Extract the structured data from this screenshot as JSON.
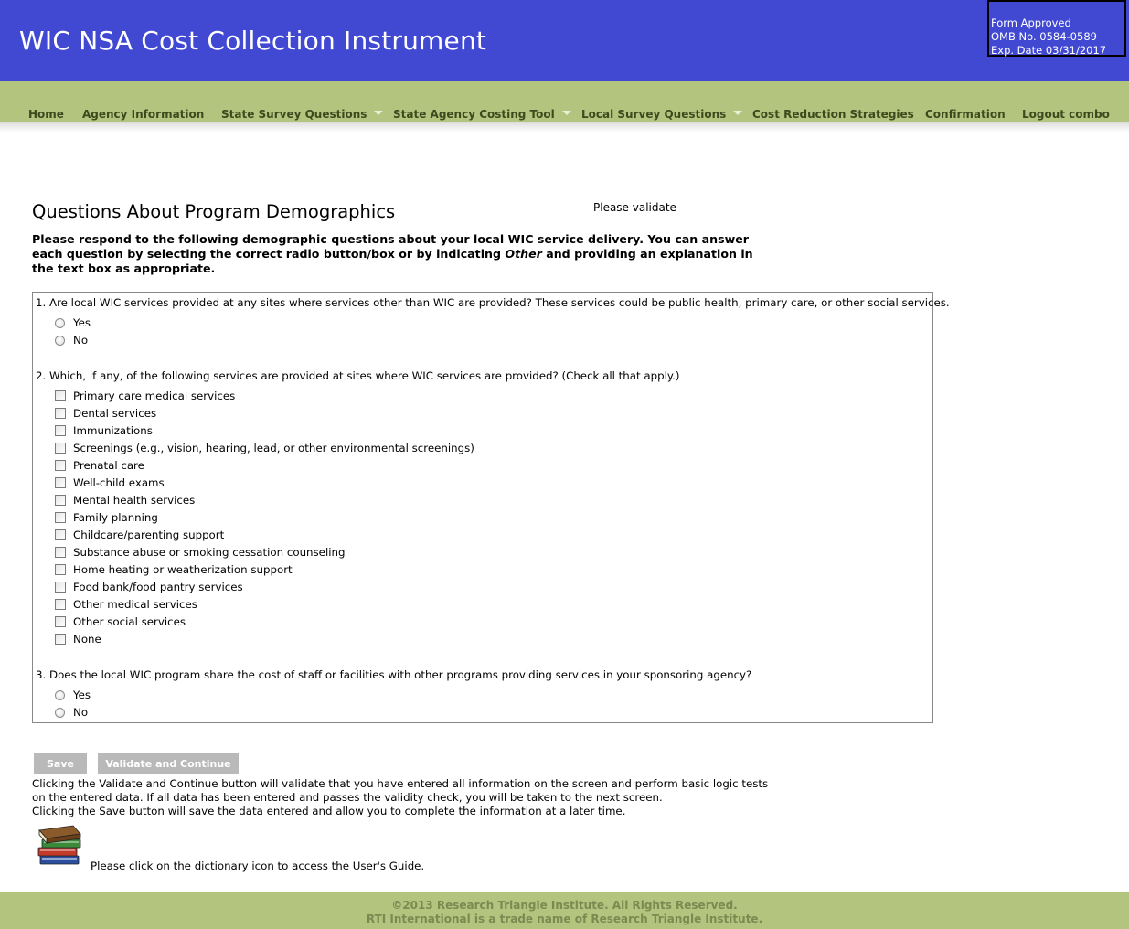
{
  "header": {
    "title": "WIC NSA Cost Collection Instrument",
    "omb": [
      "Form Approved",
      "OMB No. 0584-0589",
      "Exp. Date 03/31/2017"
    ]
  },
  "nav": {
    "items": [
      {
        "label": "Home",
        "dropdown": false
      },
      {
        "label": "Agency Information",
        "dropdown": false
      },
      {
        "label": "State Survey Questions",
        "dropdown": true
      },
      {
        "label": "State Agency Costing Tool",
        "dropdown": true
      },
      {
        "label": "Local Survey Questions",
        "dropdown": true
      },
      {
        "label": "Cost Reduction Strategies",
        "dropdown": false
      },
      {
        "label": "Confirmation",
        "dropdown": false
      },
      {
        "label": "Logout combo",
        "dropdown": false
      }
    ]
  },
  "page": {
    "heading": "Questions About Program Demographics",
    "validate_note": "Please validate",
    "intro_before": "Please respond to the following demographic questions about your local WIC service delivery. You can answer each question by selecting the correct radio button/box or by indicating ",
    "intro_em": "Other",
    "intro_after": " and providing an explanation in the text box as appropriate."
  },
  "questions": {
    "q1": {
      "text": "1. Are local WIC services provided at any sites where services other than WIC are provided? These services could be public health, primary care, or other social services.",
      "options": [
        "Yes",
        "No"
      ]
    },
    "q2": {
      "text": "2. Which, if any, of the following services are provided at sites where WIC services are provided? (Check all that apply.)",
      "options": [
        "Primary care medical services",
        "Dental services",
        "Immunizations",
        "Screenings (e.g., vision, hearing, lead, or other environmental screenings)",
        "Prenatal care",
        "Well-child exams",
        "Mental health services",
        "Family planning",
        "Childcare/parenting support",
        "Substance abuse or smoking cessation counseling",
        "Home heating or weatherization support",
        "Food bank/food pantry services",
        "Other medical services",
        "Other social services",
        "None"
      ]
    },
    "q3": {
      "text": "3. Does the local WIC program share the cost of staff or facilities with other programs providing services in your sponsoring agency?",
      "options": [
        "Yes",
        "No"
      ]
    }
  },
  "buttons": {
    "save": "Save",
    "validate": "Validate and Continue"
  },
  "help": {
    "line1": "Clicking the Validate and Continue button will validate that you have entered all information on the screen and perform basic logic tests on the entered data. If all data has been entered and passes the validity check, you will be taken to the next screen.",
    "line2": "Clicking the Save button will save the data entered and allow you to complete the information at a later time.",
    "guide": "Please click on the dictionary icon to access the User's Guide."
  },
  "footer": {
    "line1": "©2013 Research Triangle Institute. All Rights Reserved.",
    "line2": "RTI International is a trade name of Research Triangle Institute."
  },
  "colors": {
    "header_bg": "#4149d2",
    "nav_bg": "#b2c47e",
    "nav_text": "#3e4a1e",
    "button_bg": "#b9b9b9",
    "footer_text": "#7c8a52"
  },
  "icons": {
    "guide": "books-dictionary-icon",
    "nav_dropdown": "caret-down-icon"
  }
}
